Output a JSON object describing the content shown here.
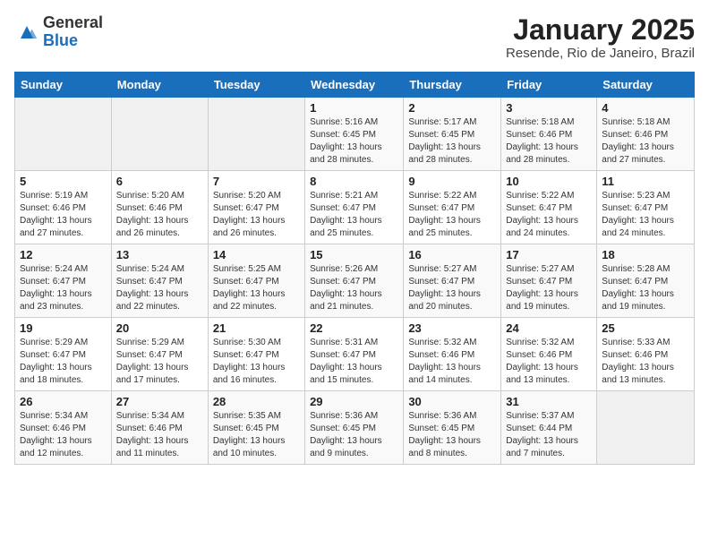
{
  "header": {
    "logo_general": "General",
    "logo_blue": "Blue",
    "month_title": "January 2025",
    "subtitle": "Resende, Rio de Janeiro, Brazil"
  },
  "days_of_week": [
    "Sunday",
    "Monday",
    "Tuesday",
    "Wednesday",
    "Thursday",
    "Friday",
    "Saturday"
  ],
  "weeks": [
    [
      {
        "day": "",
        "info": ""
      },
      {
        "day": "",
        "info": ""
      },
      {
        "day": "",
        "info": ""
      },
      {
        "day": "1",
        "info": "Sunrise: 5:16 AM\nSunset: 6:45 PM\nDaylight: 13 hours and 28 minutes."
      },
      {
        "day": "2",
        "info": "Sunrise: 5:17 AM\nSunset: 6:45 PM\nDaylight: 13 hours and 28 minutes."
      },
      {
        "day": "3",
        "info": "Sunrise: 5:18 AM\nSunset: 6:46 PM\nDaylight: 13 hours and 28 minutes."
      },
      {
        "day": "4",
        "info": "Sunrise: 5:18 AM\nSunset: 6:46 PM\nDaylight: 13 hours and 27 minutes."
      }
    ],
    [
      {
        "day": "5",
        "info": "Sunrise: 5:19 AM\nSunset: 6:46 PM\nDaylight: 13 hours and 27 minutes."
      },
      {
        "day": "6",
        "info": "Sunrise: 5:20 AM\nSunset: 6:46 PM\nDaylight: 13 hours and 26 minutes."
      },
      {
        "day": "7",
        "info": "Sunrise: 5:20 AM\nSunset: 6:47 PM\nDaylight: 13 hours and 26 minutes."
      },
      {
        "day": "8",
        "info": "Sunrise: 5:21 AM\nSunset: 6:47 PM\nDaylight: 13 hours and 25 minutes."
      },
      {
        "day": "9",
        "info": "Sunrise: 5:22 AM\nSunset: 6:47 PM\nDaylight: 13 hours and 25 minutes."
      },
      {
        "day": "10",
        "info": "Sunrise: 5:22 AM\nSunset: 6:47 PM\nDaylight: 13 hours and 24 minutes."
      },
      {
        "day": "11",
        "info": "Sunrise: 5:23 AM\nSunset: 6:47 PM\nDaylight: 13 hours and 24 minutes."
      }
    ],
    [
      {
        "day": "12",
        "info": "Sunrise: 5:24 AM\nSunset: 6:47 PM\nDaylight: 13 hours and 23 minutes."
      },
      {
        "day": "13",
        "info": "Sunrise: 5:24 AM\nSunset: 6:47 PM\nDaylight: 13 hours and 22 minutes."
      },
      {
        "day": "14",
        "info": "Sunrise: 5:25 AM\nSunset: 6:47 PM\nDaylight: 13 hours and 22 minutes."
      },
      {
        "day": "15",
        "info": "Sunrise: 5:26 AM\nSunset: 6:47 PM\nDaylight: 13 hours and 21 minutes."
      },
      {
        "day": "16",
        "info": "Sunrise: 5:27 AM\nSunset: 6:47 PM\nDaylight: 13 hours and 20 minutes."
      },
      {
        "day": "17",
        "info": "Sunrise: 5:27 AM\nSunset: 6:47 PM\nDaylight: 13 hours and 19 minutes."
      },
      {
        "day": "18",
        "info": "Sunrise: 5:28 AM\nSunset: 6:47 PM\nDaylight: 13 hours and 19 minutes."
      }
    ],
    [
      {
        "day": "19",
        "info": "Sunrise: 5:29 AM\nSunset: 6:47 PM\nDaylight: 13 hours and 18 minutes."
      },
      {
        "day": "20",
        "info": "Sunrise: 5:29 AM\nSunset: 6:47 PM\nDaylight: 13 hours and 17 minutes."
      },
      {
        "day": "21",
        "info": "Sunrise: 5:30 AM\nSunset: 6:47 PM\nDaylight: 13 hours and 16 minutes."
      },
      {
        "day": "22",
        "info": "Sunrise: 5:31 AM\nSunset: 6:47 PM\nDaylight: 13 hours and 15 minutes."
      },
      {
        "day": "23",
        "info": "Sunrise: 5:32 AM\nSunset: 6:46 PM\nDaylight: 13 hours and 14 minutes."
      },
      {
        "day": "24",
        "info": "Sunrise: 5:32 AM\nSunset: 6:46 PM\nDaylight: 13 hours and 13 minutes."
      },
      {
        "day": "25",
        "info": "Sunrise: 5:33 AM\nSunset: 6:46 PM\nDaylight: 13 hours and 13 minutes."
      }
    ],
    [
      {
        "day": "26",
        "info": "Sunrise: 5:34 AM\nSunset: 6:46 PM\nDaylight: 13 hours and 12 minutes."
      },
      {
        "day": "27",
        "info": "Sunrise: 5:34 AM\nSunset: 6:46 PM\nDaylight: 13 hours and 11 minutes."
      },
      {
        "day": "28",
        "info": "Sunrise: 5:35 AM\nSunset: 6:45 PM\nDaylight: 13 hours and 10 minutes."
      },
      {
        "day": "29",
        "info": "Sunrise: 5:36 AM\nSunset: 6:45 PM\nDaylight: 13 hours and 9 minutes."
      },
      {
        "day": "30",
        "info": "Sunrise: 5:36 AM\nSunset: 6:45 PM\nDaylight: 13 hours and 8 minutes."
      },
      {
        "day": "31",
        "info": "Sunrise: 5:37 AM\nSunset: 6:44 PM\nDaylight: 13 hours and 7 minutes."
      },
      {
        "day": "",
        "info": ""
      }
    ]
  ]
}
